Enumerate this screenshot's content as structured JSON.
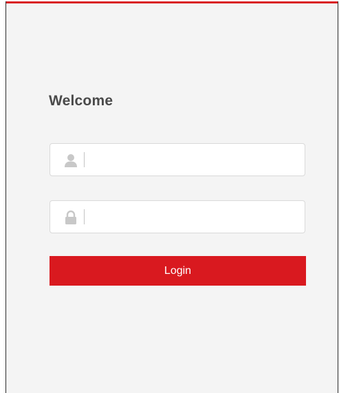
{
  "login": {
    "welcome_text": "Welcome",
    "username": {
      "value": "",
      "placeholder": "",
      "icon": "user-icon"
    },
    "password": {
      "value": "",
      "placeholder": "",
      "icon": "lock-icon"
    },
    "login_label": "Login"
  },
  "colors": {
    "accent": "#d9191f",
    "panel_background": "#f4f4f4",
    "heading_text": "#4a4a4a",
    "icon_gray": "#c8c8c8"
  }
}
